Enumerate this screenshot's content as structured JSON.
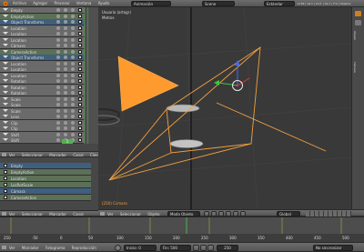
{
  "topbar": {
    "menus": [
      "Archivo",
      "Agregar",
      "Procesar",
      "Ventana",
      "Ayuda"
    ],
    "screen": "Animación",
    "scene": "Scene",
    "engine": "Estándar",
    "version": "v2.69 | Ve:1 | Ca:1 | Ve:1 | F:0 | Objetos:1/3 | Lámparas:0/0 | M"
  },
  "dopesheet": {
    "rows": [
      {
        "type": "ch",
        "label": "Empty"
      },
      {
        "type": "sub",
        "label": "EmptyAction"
      },
      {
        "type": "obj",
        "label": "Object Transforms"
      },
      {
        "type": "ch",
        "label": "Location"
      },
      {
        "type": "ch",
        "label": "Location"
      },
      {
        "type": "ch",
        "label": "Location"
      },
      {
        "type": "ch",
        "label": "Cámara"
      },
      {
        "type": "sub",
        "label": "CameraAction"
      },
      {
        "type": "obj",
        "label": "Object Transforms"
      },
      {
        "type": "ch",
        "label": "Location"
      },
      {
        "type": "ch",
        "label": "Location"
      },
      {
        "type": "ch",
        "label": "Location"
      },
      {
        "type": "ch",
        "label": "Rotation"
      },
      {
        "type": "ch",
        "label": "Rotation"
      },
      {
        "type": "ch",
        "label": "Rotation"
      },
      {
        "type": "ch",
        "label": "Scale"
      },
      {
        "type": "ch",
        "label": "Scale"
      },
      {
        "type": "ch",
        "label": "Scale"
      },
      {
        "type": "ch",
        "label": "Lens"
      },
      {
        "type": "ch",
        "label": "Clip"
      },
      {
        "type": "ch",
        "label": "Clip"
      },
      {
        "type": "ch",
        "label": "Shift"
      },
      {
        "type": "ch",
        "label": "Shift"
      }
    ],
    "current_frame": "1",
    "footer": [
      "Ver",
      "Seleccionar",
      "Marcador",
      "Canal",
      "Clave"
    ]
  },
  "nla": {
    "rows": [
      {
        "type": "obj",
        "label": "Empty"
      },
      {
        "type": "sub",
        "label": "EmptyAction"
      },
      {
        "type": "sub",
        "label": "Location"
      },
      {
        "type": "sub",
        "label": "LocRotScale"
      },
      {
        "type": "obj",
        "label": "Cámara"
      },
      {
        "type": "sub",
        "label": "CameraAction"
      }
    ],
    "footer": [
      "Ver",
      "Seleccionar",
      "Marcador",
      "Canal"
    ]
  },
  "viewport": {
    "view_label": "Usuario (ortogr)",
    "units_label": "Metros",
    "object_label": "(250) Cámara",
    "header": {
      "items": [
        "Ver",
        "Seleccionar",
        "Objeto"
      ],
      "mode": "Modo Objeto",
      "orientation": "Global"
    }
  },
  "timeline": {
    "menus": [
      "Ver",
      "Marcador",
      "Fotograma",
      "Reproducción"
    ],
    "start_label": "Inicio: 0",
    "end_label": "Fin: 500",
    "current": "250",
    "sync": "No sincronizar",
    "ruler": [
      "250",
      "-50",
      "0",
      "50",
      "100",
      "150",
      "200",
      "250",
      "300",
      "350",
      "400",
      "450",
      "500"
    ],
    "current_frame": 250
  },
  "right_strip": {
    "items": [
      "Objeto",
      "Cámara"
    ]
  },
  "colors": {
    "accent": "#ff8a1f",
    "selected_camera": "#f0a040",
    "keyframe_line": "#53b14f",
    "timeline_cursor": "#53b14f"
  }
}
